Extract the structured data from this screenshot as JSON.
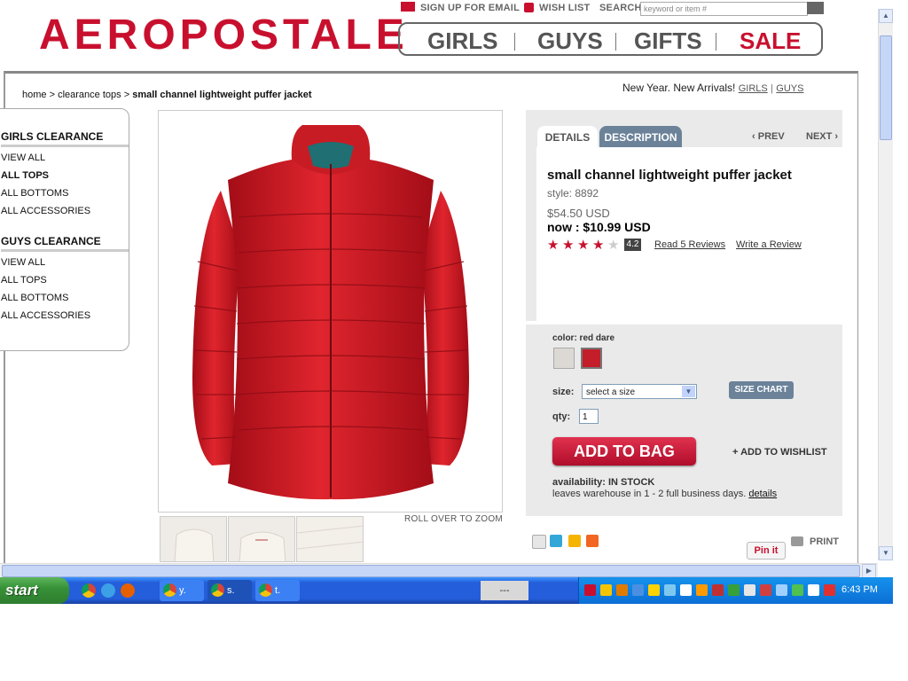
{
  "utility": {
    "signup": "SIGN UP FOR EMAIL",
    "wishlist": "WISH LIST",
    "search_label": "SEARCH",
    "search_placeholder": "keyword or item #"
  },
  "brand": {
    "logo": "AEROPOSTALE",
    "accent": "#c8102e"
  },
  "main_nav": [
    {
      "label": "GIRLS",
      "color": "#555555"
    },
    {
      "label": "GUYS",
      "color": "#555555"
    },
    {
      "label": "GIFTS",
      "color": "#555555"
    },
    {
      "label": "SALE",
      "color": "#c8102e"
    }
  ],
  "breadcrumb": {
    "home": "home",
    "sep": ">",
    "category": "clearance tops",
    "current": "small channel lightweight puffer jacket"
  },
  "promo": {
    "text": "New Year. New Arrivals!",
    "link1": "GIRLS",
    "divider": "|",
    "link2": "GUYS"
  },
  "sidebar": {
    "girls_heading": "GIRLS CLEARANCE",
    "girls_links": [
      "VIEW ALL",
      "ALL TOPS",
      "ALL BOTTOMS",
      "ALL ACCESSORIES"
    ],
    "guys_heading": "GUYS CLEARANCE",
    "guys_links": [
      "VIEW ALL",
      "ALL TOPS",
      "ALL BOTTOMS",
      "ALL ACCESSORIES"
    ]
  },
  "image": {
    "zoom_note": "ROLL OVER TO ZOOM",
    "thumbnails": [
      "thumb-front",
      "thumb-back",
      "thumb-detail"
    ]
  },
  "tabs": {
    "details": "DETAILS",
    "description": "DESCRIPTION",
    "prev": "PREV",
    "next": "NEXT"
  },
  "product": {
    "name": "small channel lightweight puffer jacket",
    "style": "style: 8892",
    "old_price": "$54.50 USD",
    "now_price": "now : $10.99 USD",
    "rating": "4.2",
    "stars_filled": 4,
    "stars_total": 5,
    "read_reviews": "Read 5 Reviews",
    "write_review": "Write a Review"
  },
  "purchase": {
    "color_label": "color: red dare",
    "swatches": [
      {
        "name": "light-grey-swatch",
        "color": "#dcd8d4"
      },
      {
        "name": "red-swatch",
        "color": "#c41e2a"
      }
    ],
    "size_label": "size:",
    "size_value": "select a size",
    "size_chart": "SIZE CHART",
    "qty_label": "qty:",
    "qty_value": "1",
    "add_to_bag": "ADD TO BAG",
    "add_to_wishlist": "ADD TO WISHLIST",
    "availability_label": "availability:",
    "availability_value": "IN STOCK",
    "leaves_text": "leaves warehouse in 1 - 2 full business days.",
    "leaves_link": "details"
  },
  "share": {
    "pinit": "Pin it",
    "print": "PRINT"
  },
  "taskbar": {
    "start": "start",
    "windows": [
      "y.",
      "s.",
      "t."
    ],
    "clock": "6:43 PM",
    "tray_mid": "---"
  }
}
